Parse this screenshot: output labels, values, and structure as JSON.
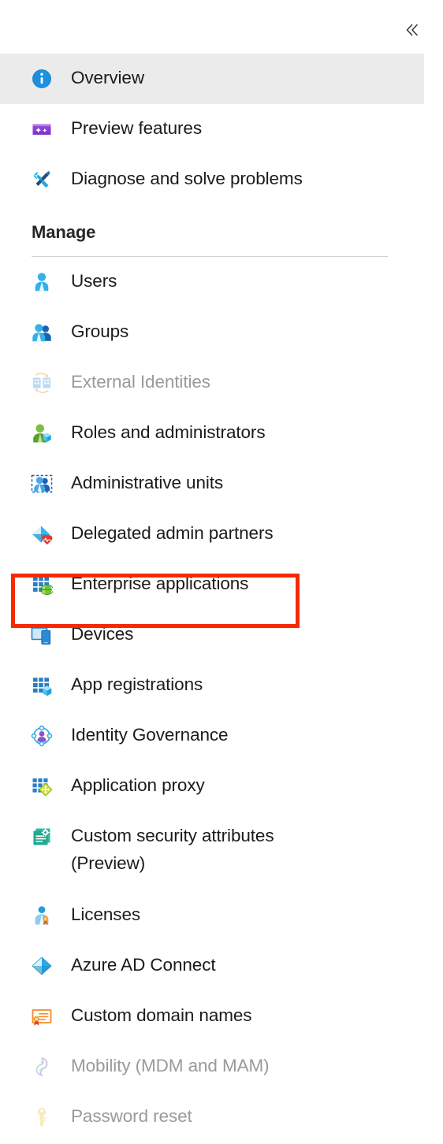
{
  "window": {
    "background_color": "#ffffff",
    "selected_row_color": "#ebebeb",
    "highlight_annotation_color": "#f62a00"
  },
  "topbar": {
    "collapse_button_label": "«",
    "collapse_button_name": "collapse-panel-button"
  },
  "nav": {
    "top_items": [
      {
        "label": "Overview",
        "icon": "info-icon",
        "selected": true,
        "disabled": false
      },
      {
        "label": "Preview features",
        "icon": "preview-features-icon",
        "selected": false,
        "disabled": false
      },
      {
        "label": "Diagnose and solve problems",
        "icon": "diagnose-tools-icon",
        "selected": false,
        "disabled": false
      }
    ],
    "section": {
      "title": "Manage"
    },
    "manage_items": [
      {
        "label": "Users",
        "icon": "user-icon",
        "selected": false,
        "disabled": false,
        "highlighted": false
      },
      {
        "label": "Groups",
        "icon": "groups-icon",
        "selected": false,
        "disabled": false,
        "highlighted": false
      },
      {
        "label": "External Identities",
        "icon": "external-identities-icon",
        "selected": false,
        "disabled": true,
        "highlighted": false
      },
      {
        "label": "Roles and administrators",
        "icon": "roles-admin-icon",
        "selected": false,
        "disabled": false,
        "highlighted": false
      },
      {
        "label": "Administrative units",
        "icon": "administrative-units-icon",
        "selected": false,
        "disabled": false,
        "highlighted": false
      },
      {
        "label": "Delegated admin partners",
        "icon": "delegated-admin-partners-icon",
        "selected": false,
        "disabled": false,
        "highlighted": false
      },
      {
        "label": "Enterprise applications",
        "icon": "enterprise-applications-icon",
        "selected": false,
        "disabled": false,
        "highlighted": true
      },
      {
        "label": "Devices",
        "icon": "devices-icon",
        "selected": false,
        "disabled": false,
        "highlighted": false
      },
      {
        "label": "App registrations",
        "icon": "app-registrations-icon",
        "selected": false,
        "disabled": false,
        "highlighted": false
      },
      {
        "label": "Identity Governance",
        "icon": "identity-governance-icon",
        "selected": false,
        "disabled": false,
        "highlighted": false
      },
      {
        "label": "Application proxy",
        "icon": "application-proxy-icon",
        "selected": false,
        "disabled": false,
        "highlighted": false
      },
      {
        "label": "Custom security attributes (Preview)",
        "icon": "custom-security-attributes-icon",
        "selected": false,
        "disabled": false,
        "highlighted": false,
        "two_line": true
      },
      {
        "label": "Licenses",
        "icon": "licenses-icon",
        "selected": false,
        "disabled": false,
        "highlighted": false
      },
      {
        "label": "Azure AD Connect",
        "icon": "azure-ad-connect-icon",
        "selected": false,
        "disabled": false,
        "highlighted": false
      },
      {
        "label": "Custom domain names",
        "icon": "custom-domain-names-icon",
        "selected": false,
        "disabled": false,
        "highlighted": false
      },
      {
        "label": "Mobility (MDM and MAM)",
        "icon": "mobility-mdm-mam-icon",
        "selected": false,
        "disabled": true,
        "highlighted": false
      },
      {
        "label": "Password reset",
        "icon": "password-reset-icon",
        "selected": false,
        "disabled": true,
        "highlighted": false
      }
    ]
  }
}
